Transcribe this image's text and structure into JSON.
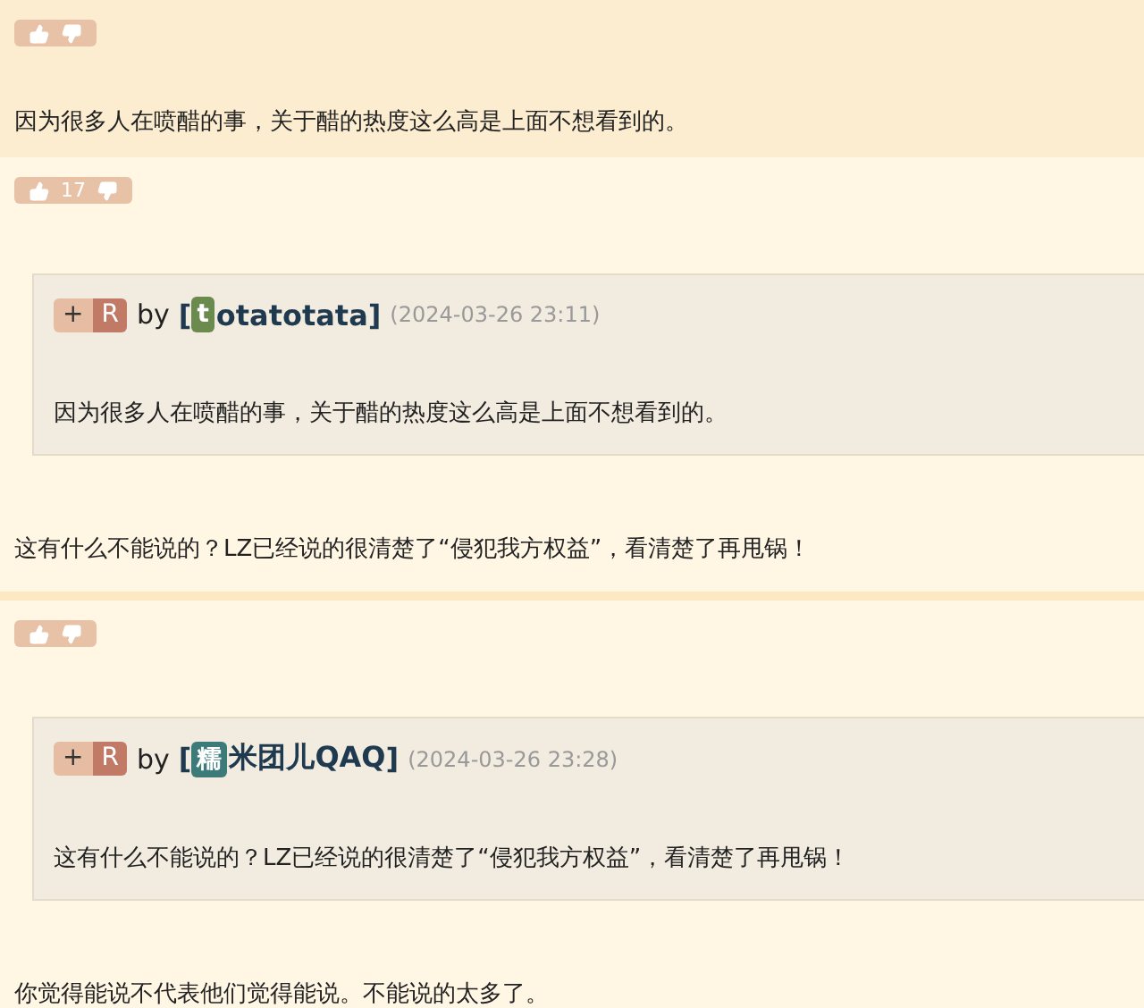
{
  "sections": [
    {
      "highlighted": true,
      "items": [
        {
          "kind": "votes"
        },
        {
          "kind": "text",
          "text": "因为很多人在喷醋的事，关于醋的热度这么高是上面不想看到的。"
        }
      ]
    },
    {
      "highlighted": false,
      "items": [
        {
          "kind": "votes",
          "count": "17"
        },
        {
          "kind": "quote",
          "plus": "+",
          "r": "R",
          "by": "by",
          "open": "[",
          "avatar": "t",
          "color": "#6b8a4e",
          "user": "otatotata",
          "close": "]",
          "date": "(2024-03-26 23:11)",
          "text": "因为很多人在喷醋的事，关于醋的热度这么高是上面不想看到的。"
        },
        {
          "kind": "text",
          "text": "这有什么不能说的？LZ已经说的很清楚了“侵犯我方权益”，看清楚了再甩锅！"
        }
      ]
    },
    {
      "highlighted": false,
      "items": [
        {
          "kind": "votes"
        },
        {
          "kind": "quote",
          "plus": "+",
          "r": "R",
          "by": "by",
          "open": "[",
          "avatar": "糯",
          "color": "#3d7a7a",
          "user": "米团儿QAQ",
          "close": "]",
          "date": "(2024-03-26 23:28)",
          "text": "这有什么不能说的？LZ已经说的很清楚了“侵犯我方权益”，看清楚了再甩锅！"
        },
        {
          "kind": "text",
          "text": "你觉得能说不代表他们觉得能说。不能说的太多了。"
        }
      ]
    }
  ]
}
